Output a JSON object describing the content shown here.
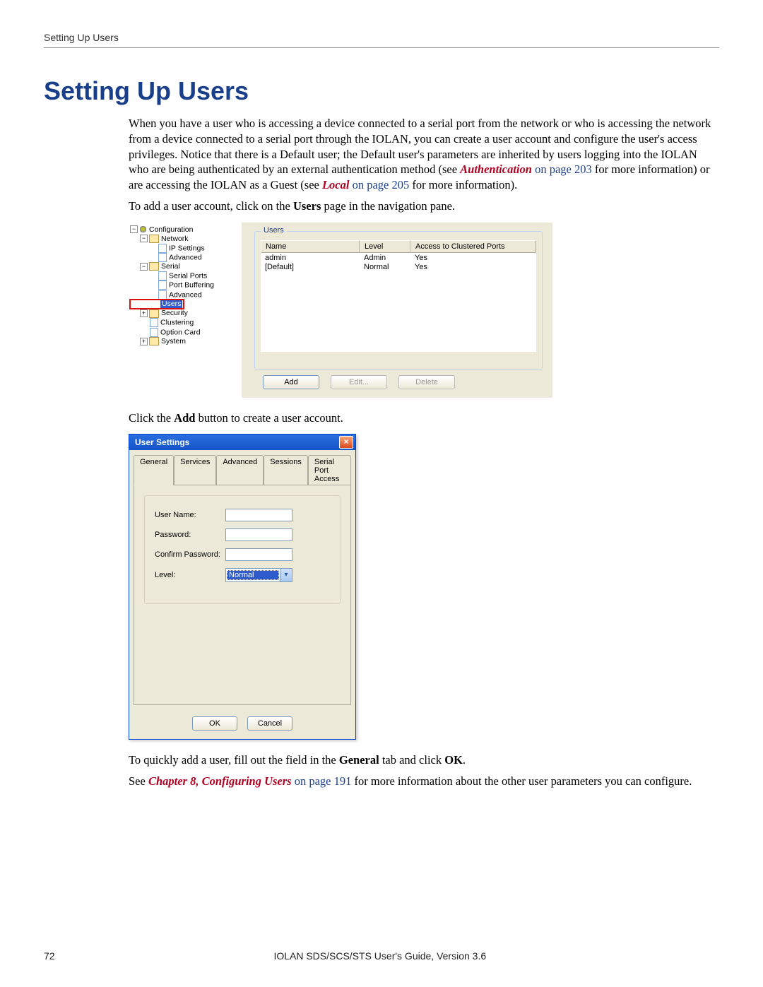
{
  "header": {
    "running": "Setting Up Users"
  },
  "heading": "Setting Up Users",
  "para1_a": "When you have a user who is accessing a device connected to a serial port from the network or who is accessing the network from a device connected to a serial port through the IOLAN, you can create a user account and configure the user's access privileges. Notice that there is a Default user; the Default user's parameters are inherited by users logging into the IOLAN who are being authenticated by an external authentication method (see ",
  "link1_a": "Authentication",
  "link1_b": " on page 203",
  "para1_b": " for more information) or are accessing the IOLAN as a Guest (see ",
  "link2_a": "Local",
  "link2_b": " on page 205",
  "para1_c": " for more information).",
  "para2_a": "To add a user account, click on the ",
  "para2_bold": "Users",
  "para2_b": " page in the navigation pane.",
  "tree": {
    "configuration": "Configuration",
    "network": "Network",
    "ip_settings": "IP Settings",
    "advanced": "Advanced",
    "serial": "Serial",
    "serial_ports": "Serial Ports",
    "port_buffering": "Port Buffering",
    "serial_advanced": "Advanced",
    "users": "Users",
    "security": "Security",
    "clustering": "Clustering",
    "option_card": "Option Card",
    "system": "System"
  },
  "users_panel": {
    "group_title": "Users",
    "columns": {
      "name": "Name",
      "level": "Level",
      "acp": "Access to Clustered Ports"
    },
    "rows": [
      {
        "name": "admin",
        "level": "Admin",
        "acp": "Yes"
      },
      {
        "name": "[Default]",
        "level": "Normal",
        "acp": "Yes"
      }
    ],
    "buttons": {
      "add": "Add",
      "edit": "Edit...",
      "delete": "Delete"
    }
  },
  "para3_a": "Click the ",
  "para3_bold": "Add",
  "para3_b": " button to create a user account.",
  "dialog": {
    "title": "User Settings",
    "close": "×",
    "tabs": [
      "General",
      "Services",
      "Advanced",
      "Sessions",
      "Serial Port Access"
    ],
    "fields": {
      "username_label": "User Name:",
      "password_label": "Password:",
      "confirm_label": "Confirm Password:",
      "level_label": "Level:",
      "level_value": "Normal"
    },
    "buttons": {
      "ok": "OK",
      "cancel": "Cancel"
    }
  },
  "para4_a": "To quickly add a user, fill out the field in the ",
  "para4_bold1": "General",
  "para4_b": " tab and click ",
  "para4_bold2": "OK",
  "para4_c": ".",
  "para5_a": "See ",
  "para5_link_a": "Chapter 8, Configuring Users",
  "para5_link_b": " on page 191",
  "para5_b": " for more information about the other user parameters you can configure.",
  "footer": {
    "page": "72",
    "guide": "IOLAN SDS/SCS/STS User's Guide, Version 3.6"
  }
}
